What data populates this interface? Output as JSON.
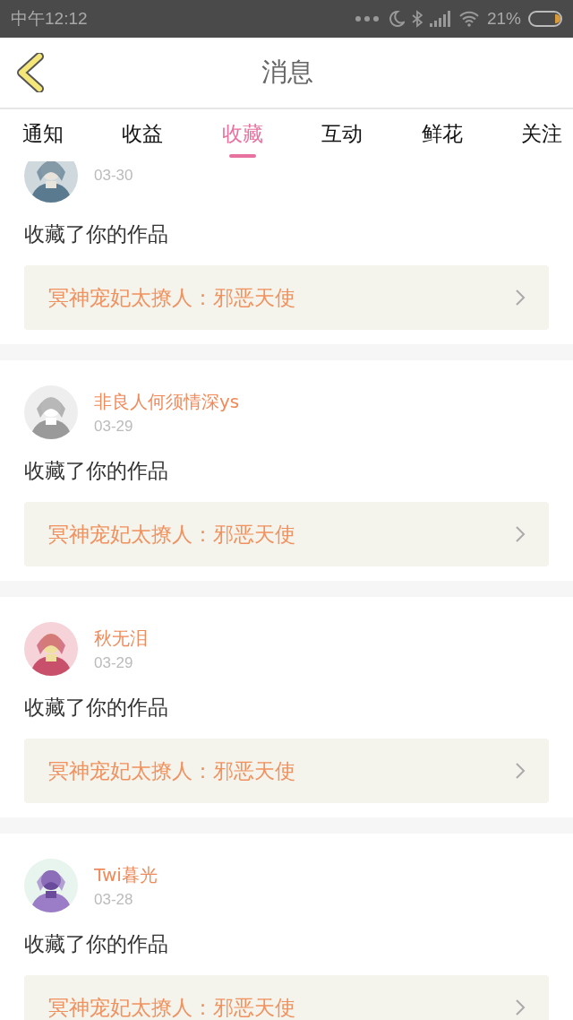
{
  "status_bar": {
    "time": "中午12:12",
    "battery": "21%"
  },
  "header": {
    "title": "消息"
  },
  "tabs": [
    {
      "label": "通知",
      "selected": false
    },
    {
      "label": "收益",
      "selected": false
    },
    {
      "label": "收藏",
      "selected": true
    },
    {
      "label": "互动",
      "selected": false
    },
    {
      "label": "鲜花",
      "selected": false
    },
    {
      "label": "关注",
      "selected": false
    }
  ],
  "messages": [
    {
      "date": "03-30",
      "text": "收藏了你的作品",
      "work": "冥神宠妃太撩人：邪恶天使"
    },
    {
      "name": "非良人何须情深ys",
      "date": "03-29",
      "text": "收藏了你的作品",
      "work": "冥神宠妃太撩人：邪恶天使"
    },
    {
      "name": "秋无泪",
      "date": "03-29",
      "text": "收藏了你的作品",
      "work": "冥神宠妃太撩人：邪恶天使"
    },
    {
      "name": "Twi暮光",
      "date": "03-28",
      "text": "收藏了你的作品",
      "work": "冥神宠妃太撩人：邪恶天使"
    }
  ]
}
